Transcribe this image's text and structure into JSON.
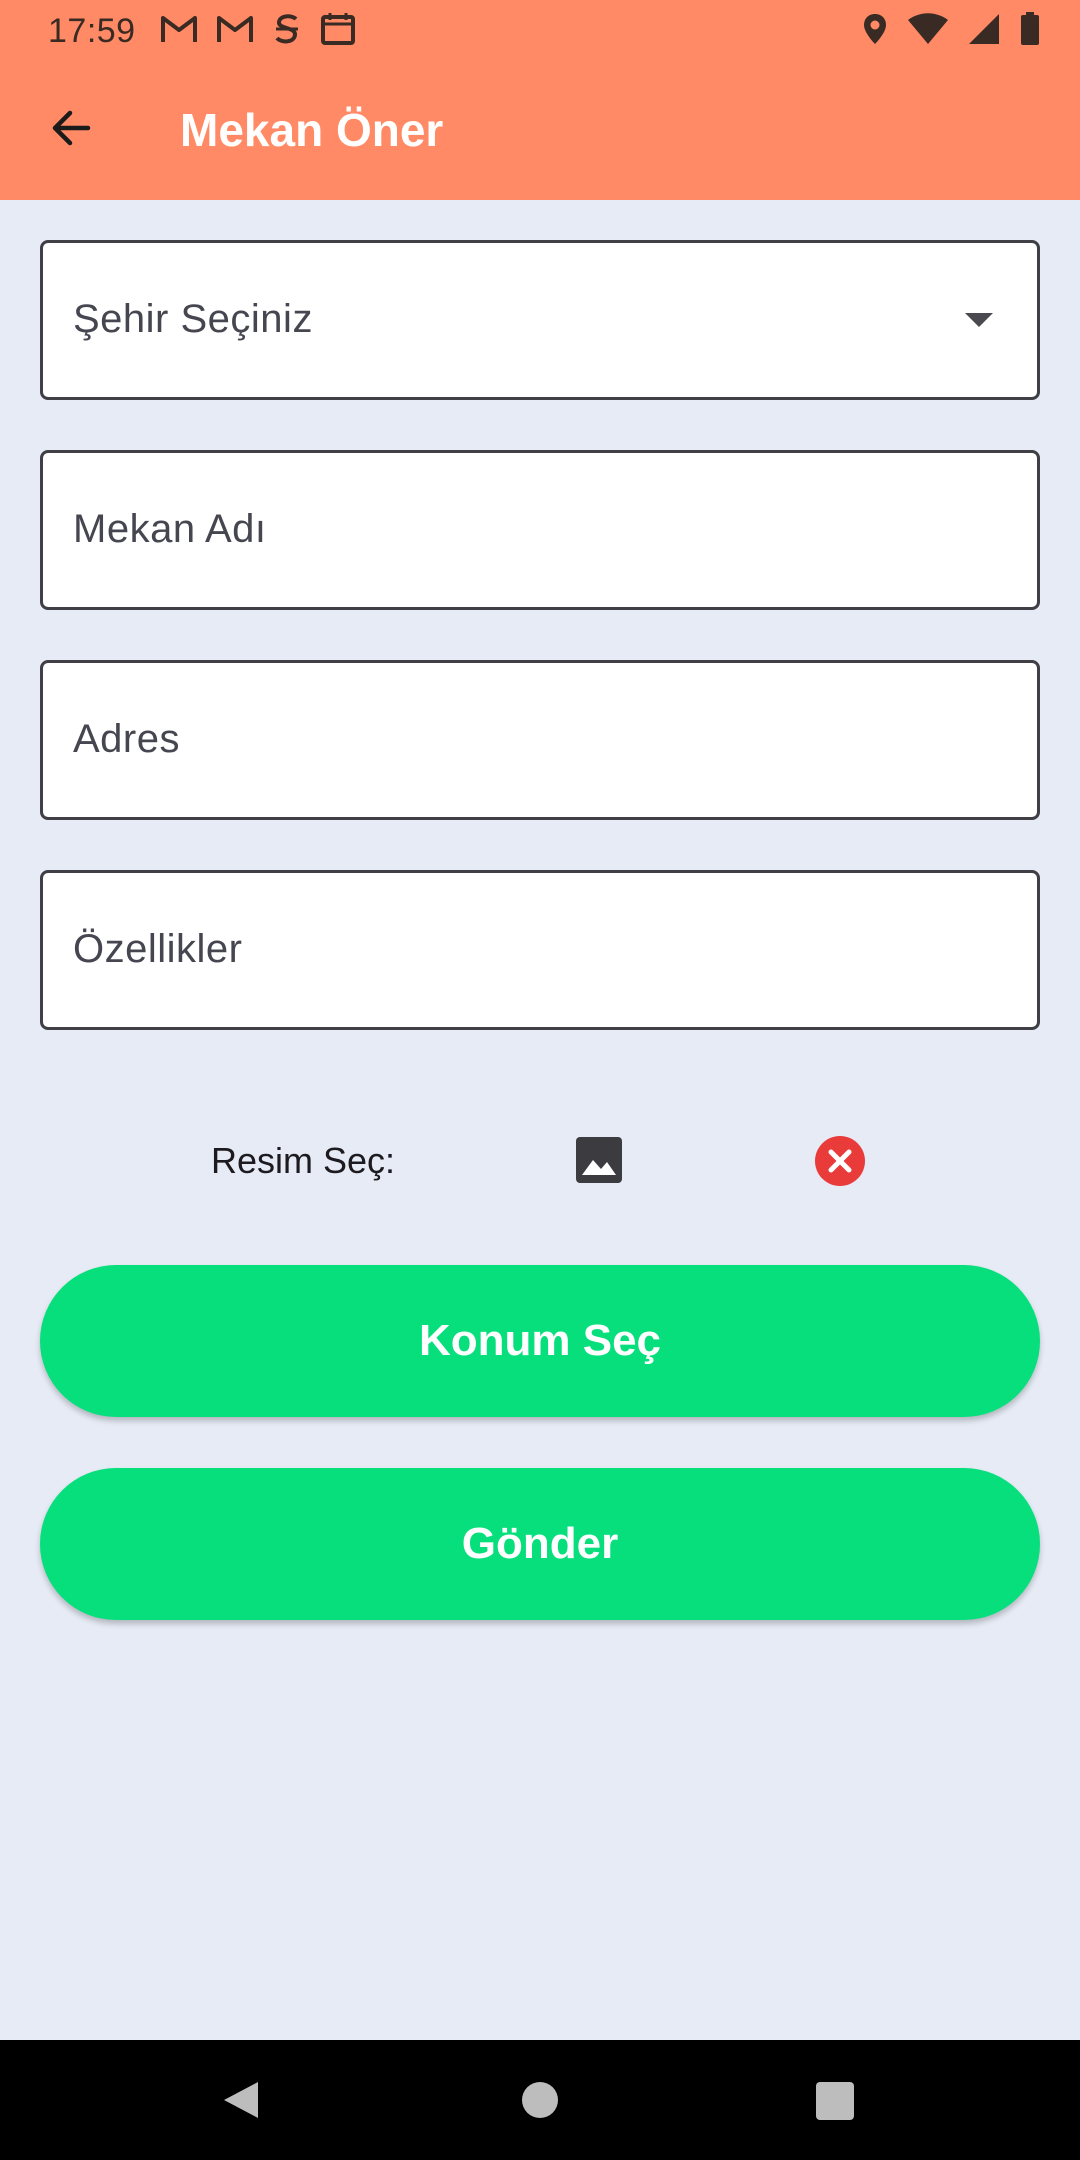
{
  "status_bar": {
    "time": "17:59",
    "left_icons": [
      "gmail-icon",
      "gmail-icon",
      "s-app-icon",
      "calendar-icon"
    ],
    "right_icons": [
      "location-icon",
      "wifi-icon",
      "signal-icon",
      "battery-icon"
    ]
  },
  "app_bar": {
    "title": "Mekan Öner",
    "back_icon": "arrow-back-icon"
  },
  "form": {
    "city_select": {
      "value": "Şehir Seçiniz",
      "icon": "dropdown-caret-icon"
    },
    "place_name": {
      "placeholder": "Mekan Adı"
    },
    "address": {
      "placeholder": "Adres"
    },
    "features": {
      "placeholder": "Özellikler"
    },
    "image_picker": {
      "label": "Resim Seç:",
      "pick_icon": "image-icon",
      "clear_icon": "cancel-icon",
      "clear_color": "#ea3b3b"
    }
  },
  "buttons": {
    "location": "Konum Seç",
    "submit": "Gönder"
  },
  "colors": {
    "app_bar": "#ff8a65",
    "button": "#06df7c",
    "background": "#e6ebf5"
  }
}
